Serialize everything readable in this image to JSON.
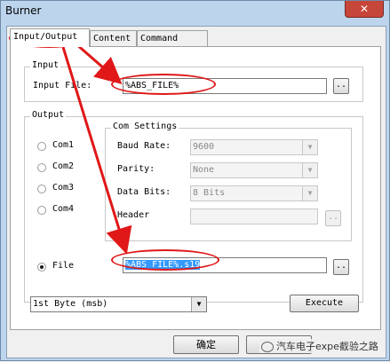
{
  "window": {
    "title": "Burner",
    "close_glyph": "✕"
  },
  "tabs": [
    {
      "label": "Input/Output"
    },
    {
      "label": "Content"
    },
    {
      "label": "Command File"
    }
  ],
  "input_group": {
    "title": "Input",
    "file_label": "Input File:",
    "file_value": "%ABS_FILE%",
    "browse_label": ".."
  },
  "output_group": {
    "title": "Output",
    "radios": [
      {
        "label": "Com1",
        "selected": false
      },
      {
        "label": "Com2",
        "selected": false
      },
      {
        "label": "Com3",
        "selected": false
      },
      {
        "label": "Com4",
        "selected": false
      }
    ],
    "com_settings": {
      "title": "Com Settings",
      "baud_label": "Baud Rate:",
      "baud_value": "9600",
      "parity_label": "Parity:",
      "parity_value": "None",
      "databits_label": "Data Bits:",
      "databits_value": "8 Bits",
      "header_label": "Header",
      "header_browse": ".."
    },
    "file_radio": {
      "label": "File",
      "selected": true
    },
    "file_value": "%ABS_FILE%.s19",
    "file_browse": ".."
  },
  "byte_select": {
    "value": "1st Byte (msb)"
  },
  "execute_label": "Execute",
  "ok_label": "确定",
  "watermark": "汽车电子expe截验之路",
  "colors": {
    "annotation": "#e01818",
    "selection": "#3399ff"
  }
}
